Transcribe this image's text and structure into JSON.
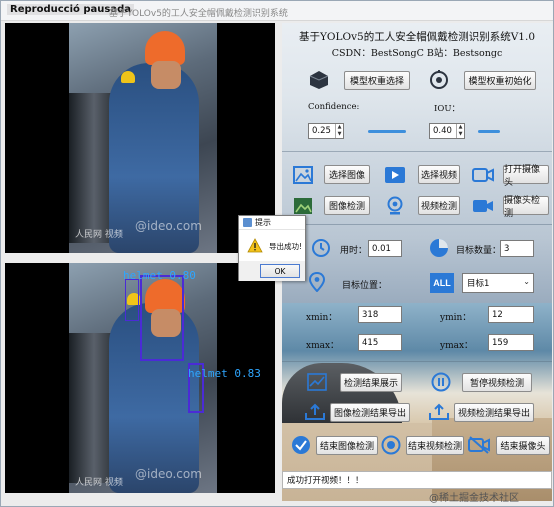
{
  "window": {
    "overlay_title": "Reproducció pausada",
    "title": "基于YOLOv5的工人安全帽佩戴检测识别系统"
  },
  "video": {
    "watermark_text": "@ideo.com",
    "logo_text": "人民网 视频"
  },
  "detections": [
    {
      "label": "helmet",
      "score": "0.80"
    },
    {
      "label": "helmet",
      "score": "0.83"
    }
  ],
  "panel": {
    "title": "基于YOLOv5的工人安全帽佩戴检测识别系统V1.0",
    "subtitle": "CSDN：BestSongC   B站：Bestsongc",
    "buttons": {
      "model_select": "模型权重选择",
      "model_init": "模型权重初始化",
      "select_image": "选择图像",
      "select_video": "选择视频",
      "open_camera": "打开摄像头",
      "image_detect": "图像检测",
      "video_detect": "视频检测",
      "camera_detect": "摄像头检测",
      "show_results": "检测结果展示",
      "pause_video": "暂停视频检测",
      "export_image": "图像检测结果导出",
      "export_video": "视频检测结果导出",
      "end_image": "结束图像检测",
      "end_video": "结束视频检测",
      "end_camera": "结束摄像头"
    },
    "confidence": {
      "label": "Confidence:",
      "value": "0.25",
      "slider_fraction": 0.25
    },
    "iou": {
      "label": "IOU：",
      "value": "0.40",
      "slider_fraction": 0.4
    },
    "time": {
      "label": "用时：",
      "value": "0.01"
    },
    "target_count": {
      "label": "目标数量：",
      "value": "3"
    },
    "target_position": {
      "label": "目标位置：",
      "selected": "目标1"
    },
    "coords": {
      "xmin_label": "xmin：",
      "xmin": "318",
      "ymin_label": "ymin：",
      "ymin": "12",
      "xmax_label": "xmax：",
      "xmax": "415",
      "ymax_label": "ymax：",
      "ymax": "159"
    },
    "status": "成功打开视频！！！"
  },
  "dialog": {
    "title": "提示",
    "message": "导出成功!",
    "ok": "OK"
  },
  "footer": {
    "brand": "@稀土掘金技术社区"
  },
  "colors": {
    "accent": "#3d8fdc",
    "bbox": "#4b2bd6",
    "bbox_label": "#2ea6ff",
    "helmet": "#ee6b2b"
  }
}
